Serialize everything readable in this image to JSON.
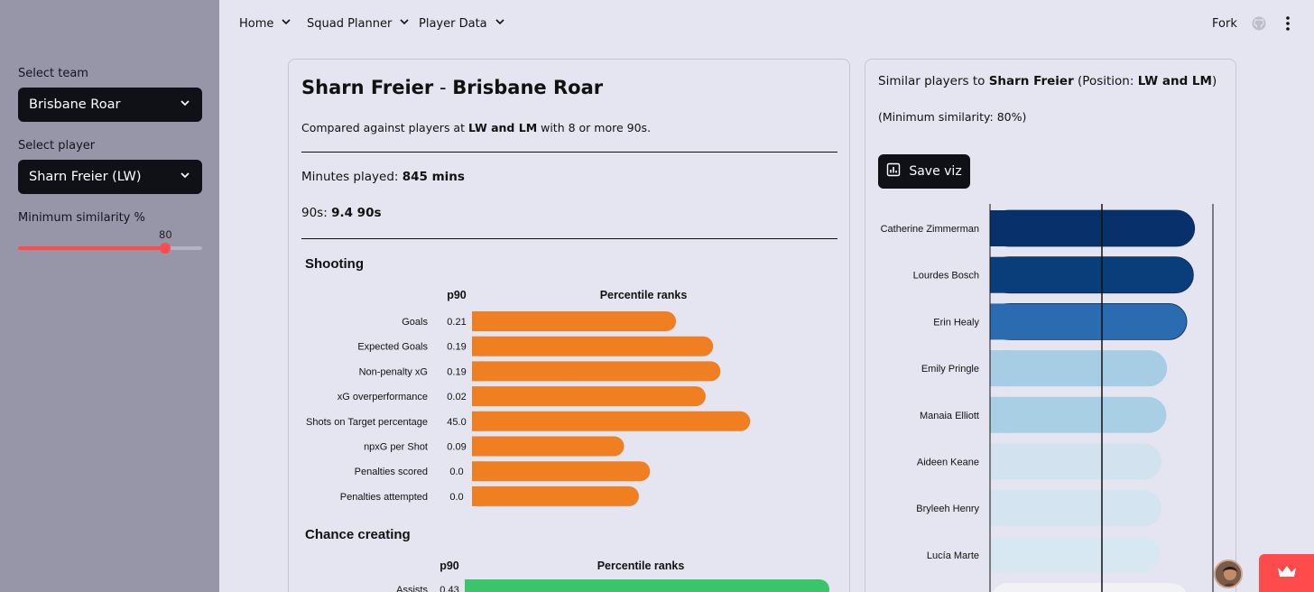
{
  "sidebar": {
    "team_label": "Select team",
    "team_value": "Brisbane Roar",
    "player_label": "Select player",
    "player_value": "Sharn Freier (LW)",
    "similarity_label": "Minimum similarity %",
    "similarity_value": "80",
    "similarity_fraction": 0.8
  },
  "nav": {
    "items": [
      {
        "label": "Home"
      },
      {
        "label": "Squad Planner"
      },
      {
        "label": "Player Data"
      }
    ],
    "fork_label": "Fork"
  },
  "profile": {
    "player": "Sharn Freier",
    "separator": " - ",
    "team": "Brisbane Roar",
    "compared_pre": "Compared against players at ",
    "compared_pos": "LW and LM",
    "compared_post": " with 8 or more 90s.",
    "minutes_label": "Minutes played: ",
    "minutes_value": "845 mins",
    "nineties_label": "90s: ",
    "nineties_value": "9.4 90s"
  },
  "similar": {
    "pre": "Similar players to ",
    "player": "Sharn Freier",
    "mid": " (Position: ",
    "position": "LW and LM",
    "post": ")",
    "min_text": "(Minimum similarity: 80%)",
    "save_label": "Save viz"
  },
  "colors": {
    "shooting_bar": "#f07f22",
    "chance_bar": "#3bc46c",
    "accent": "#ff4b4b"
  },
  "chart_data": [
    {
      "type": "bar",
      "title": "Shooting",
      "col_p90": "p90",
      "col_pct": "Percentile ranks",
      "categories": [
        "Goals",
        "Expected Goals",
        "Non-penalty xG",
        "xG overperformance",
        "Shots on Target percentage",
        "npxG per Shot",
        "Penalties scored",
        "Penalties attempted"
      ],
      "p90": [
        "0.21",
        "0.19",
        "0.19",
        "0.02",
        "45.0",
        "0.09",
        "0.0",
        "0.0"
      ],
      "values": [
        55,
        65,
        67,
        63,
        75,
        41,
        48,
        45
      ],
      "xlim": [
        0,
        100
      ],
      "color": "#f07f22"
    },
    {
      "type": "bar",
      "title": "Chance creating",
      "col_p90": "p90",
      "col_pct": "Percentile ranks",
      "categories": [
        "Assists"
      ],
      "p90": [
        "0.43"
      ],
      "values": [
        100
      ],
      "xlim": [
        0,
        100
      ],
      "color": "#3bc46c"
    },
    {
      "type": "bar",
      "categories": [
        "Catherine Zimmerman",
        "Lourdes Bosch",
        "Erin Healy",
        "Emily Pringle",
        "Manaia Elliott",
        "Aideen Keane",
        "Bryleeh Henry",
        "Lucía Marte"
      ],
      "values": [
        94.1,
        93.9,
        92.8,
        89.5,
        89.4,
        88.6,
        88.6,
        88.4
      ],
      "xlim": [
        60,
        100
      ],
      "reference_lines": [
        80,
        100
      ],
      "colors": [
        "#08306b",
        "#0a3e7a",
        "#2b6cb0",
        "#a6cde3",
        "#a9cfe4",
        "#d2e3ef",
        "#d4e4f0",
        "#d8e8f3"
      ]
    }
  ]
}
